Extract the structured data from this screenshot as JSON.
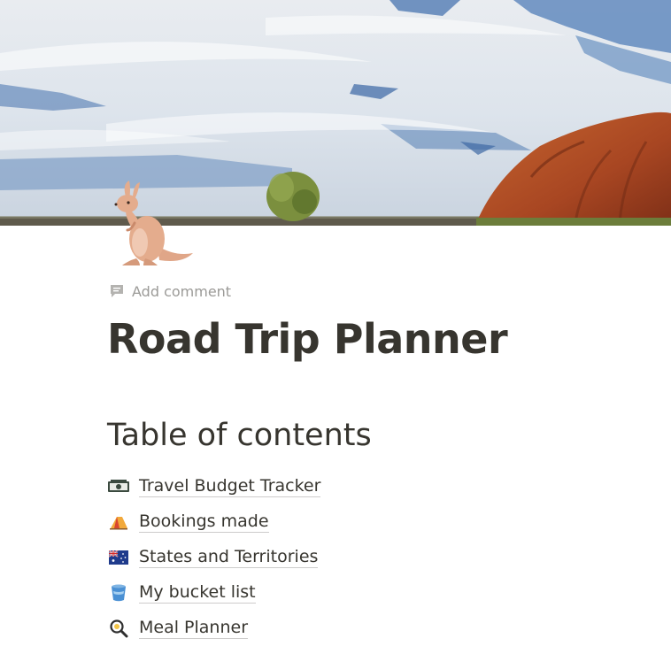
{
  "cover": {
    "image": "uluru-outback-sky"
  },
  "page_icon": "kangaroo-icon",
  "add_comment_label": "Add comment",
  "title": "Road Trip Planner",
  "toc": {
    "heading": "Table of contents",
    "items": [
      {
        "icon": "money-icon",
        "label": "Travel Budget Tracker"
      },
      {
        "icon": "tent-icon",
        "label": "Bookings made"
      },
      {
        "icon": "australia-flag-icon",
        "label": "States and Territories"
      },
      {
        "icon": "cup-icon",
        "label": "My bucket list"
      },
      {
        "icon": "magnifier-icon",
        "label": "Meal Planner"
      }
    ]
  },
  "colors": {
    "text": "#37352f",
    "muted": "#9b9a97",
    "sky": "#5f86b8",
    "rock": "#b3542a"
  }
}
